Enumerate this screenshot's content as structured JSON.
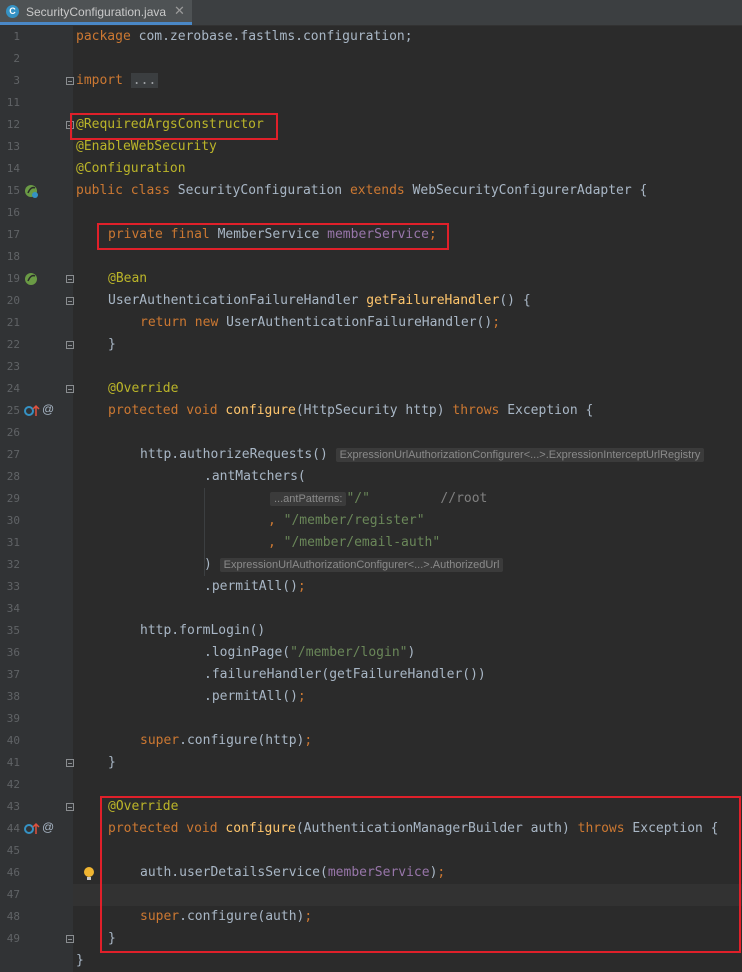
{
  "tab": {
    "icon": "java-class-icon",
    "icon_glyph": "C",
    "file_name": "SecurityConfiguration.java",
    "close_glyph": "✕"
  },
  "line_numbers": [
    "1",
    "2",
    "3",
    "11",
    "12",
    "13",
    "14",
    "15",
    "16",
    "17",
    "18",
    "19",
    "20",
    "21",
    "22",
    "23",
    "24",
    "25",
    "26",
    "27",
    "28",
    "29",
    "30",
    "31",
    "32",
    "33",
    "34",
    "35",
    "36",
    "37",
    "38",
    "39",
    "40",
    "41",
    "42",
    "43",
    "44",
    "45",
    "46",
    "47",
    "48",
    "49"
  ],
  "code": {
    "l1_kw": "package",
    "l1_txt": " com.zerobase.fastlms.configuration;",
    "l3_kw": "import",
    "l3_fold": "...",
    "l12": "@RequiredArgsConstructor",
    "l13": "@EnableWebSecurity",
    "l14": "@Configuration",
    "l15_kw1": "public class",
    "l15_name": " SecurityConfiguration ",
    "l15_kw2": "extends",
    "l15_rest": " WebSecurityConfigurerAdapter {",
    "l17_kw": "private final",
    "l17_type": " MemberService ",
    "l17_field": "memberService",
    "l17_semi": ";",
    "l19": "@Bean",
    "l20_type": "UserAuthenticationFailureHandler ",
    "l20_fn": "getFailureHandler",
    "l20_rest": "() {",
    "l21_kw": "return new",
    "l21_rest": " UserAuthenticationFailureHandler()",
    "l21_semi": ";",
    "l22": "}",
    "l24": "@Override",
    "l25_kw": "protected void",
    "l25_fn": " configure",
    "l25_mid": "(HttpSecurity http) ",
    "l25_kw2": "throws",
    "l25_rest": " Exception {",
    "l27_code": "http.authorizeRequests()",
    "l27_hint": "ExpressionUrlAuthorizationConfigurer<...>.ExpressionInterceptUrlRegistry",
    "l28": ".antMatchers(",
    "l29_hint": "...antPatterns:",
    "l29_str": "\"/\"",
    "l29_cmt": "//root",
    "l30_comma": ",",
    "l30_str": "\"/member/register\"",
    "l31_comma": ",",
    "l31_str": "\"/member/email-auth\"",
    "l32_code": ")",
    "l32_hint": "ExpressionUrlAuthorizationConfigurer<...>.AuthorizedUrl",
    "l33": ".permitAll()",
    "l33_semi": ";",
    "l35": "http.formLogin()",
    "l36_a": ".loginPage(",
    "l36_str": "\"/member/login\"",
    "l36_b": ")",
    "l37": ".failureHandler(getFailureHandler())",
    "l38": ".permitAll()",
    "l38_semi": ";",
    "l40_kw": "super",
    "l40_rest": ".configure(http)",
    "l40_semi": ";",
    "l41": "}",
    "l43": "@Override",
    "l44_kw": "protected void",
    "l44_fn": " configure",
    "l44_mid": "(AuthenticationManagerBuilder auth) ",
    "l44_kw2": "throws",
    "l44_rest": " Exception {",
    "l46_a": "auth.userDetailsService(",
    "l46_field": "memberService",
    "l46_b": ")",
    "l46_semi": ";",
    "l48_kw": "super",
    "l48_rest": ".configure(auth)",
    "l48_semi": ";",
    "l49": "}",
    "l50": "}"
  },
  "gutter_icons": {
    "class_icon": "spring-bean-class-icon",
    "bean_icon": "spring-bean-icon",
    "override_icon": "override-arrow-icon",
    "at_glyph": "@",
    "bulb_icon": "lightbulb-icon"
  },
  "colors": {
    "background": "#2b2b2b",
    "keyword": "#cc7832",
    "annotation": "#bbb529",
    "string": "#6a8759",
    "field": "#9876aa",
    "function": "#ffc66d",
    "highlight_box": "#e0202a"
  }
}
